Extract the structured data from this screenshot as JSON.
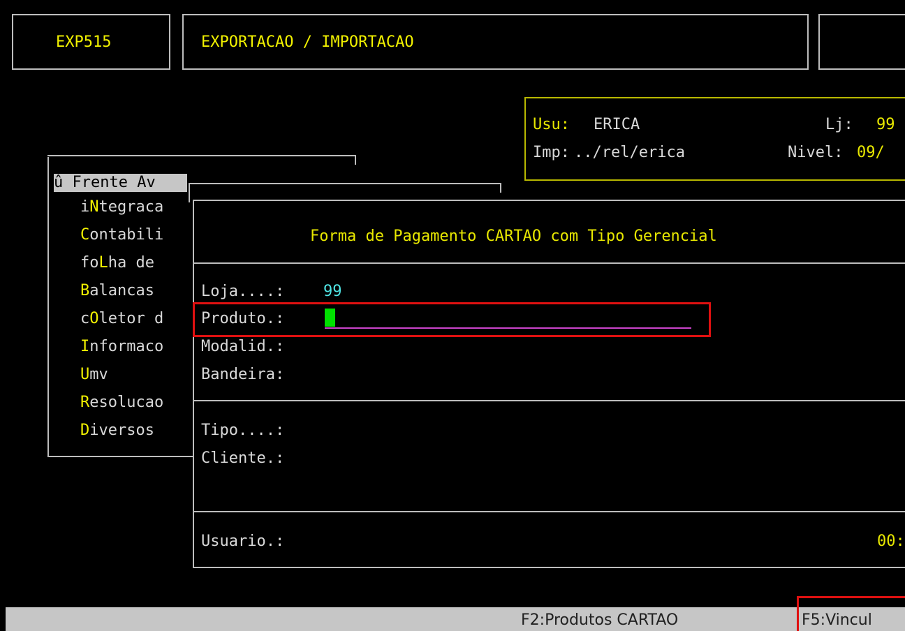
{
  "header": {
    "program_code": "EXP515",
    "title": "EXPORTACAO / IMPORTACAO"
  },
  "user_info": {
    "user_label": "Usu:",
    "user_value": "ERICA",
    "store_label": "Lj:",
    "store_value": "99",
    "printer_label": "Imp:",
    "printer_value": "../rel/erica",
    "level_label": "Nivel:",
    "level_value": "09/"
  },
  "menu": {
    "selected_item": "û Frente Av",
    "items": [
      {
        "hotkey": "",
        "before": "i",
        "key": "N",
        "after": "tegraca"
      },
      {
        "before": "",
        "key": "C",
        "after": "ontabili"
      },
      {
        "before": "fo",
        "key": "L",
        "after": "ha de"
      },
      {
        "before": "",
        "key": "B",
        "after": "alancas"
      },
      {
        "before": "c",
        "key": "O",
        "after": "letor d"
      },
      {
        "before": "",
        "key": "I",
        "after": "nformaco"
      },
      {
        "before": "",
        "key": "U",
        "after": "mv"
      },
      {
        "before": "",
        "key": "R",
        "after": "esolucao"
      },
      {
        "before": "",
        "key": "D",
        "after": "iversos"
      }
    ]
  },
  "dialog": {
    "title": "Forma de Pagamento CARTAO com Tipo Gerencial",
    "loja_label": "Loja....:",
    "loja_value": "99",
    "produto_label": "Produto.:",
    "produto_value": "",
    "modalidade_label": "Modalid.:",
    "bandeira_label": "Bandeira:",
    "tipo_label": "Tipo....:",
    "cliente_label": "Cliente.:",
    "usuario_label": "Usuario.:",
    "usuario_time": "00:"
  },
  "status_bar": {
    "f2": "F2:Produtos CARTAO",
    "f5": "F5:Vincul"
  },
  "colors": {
    "background": "#000000",
    "hotkey": "#f2f200",
    "value": "#4fe3e3",
    "cursor": "#00e000",
    "field_underline": "#cc44cc",
    "highlight_box": "#e01010",
    "status_bar": "#c6c6c6"
  }
}
